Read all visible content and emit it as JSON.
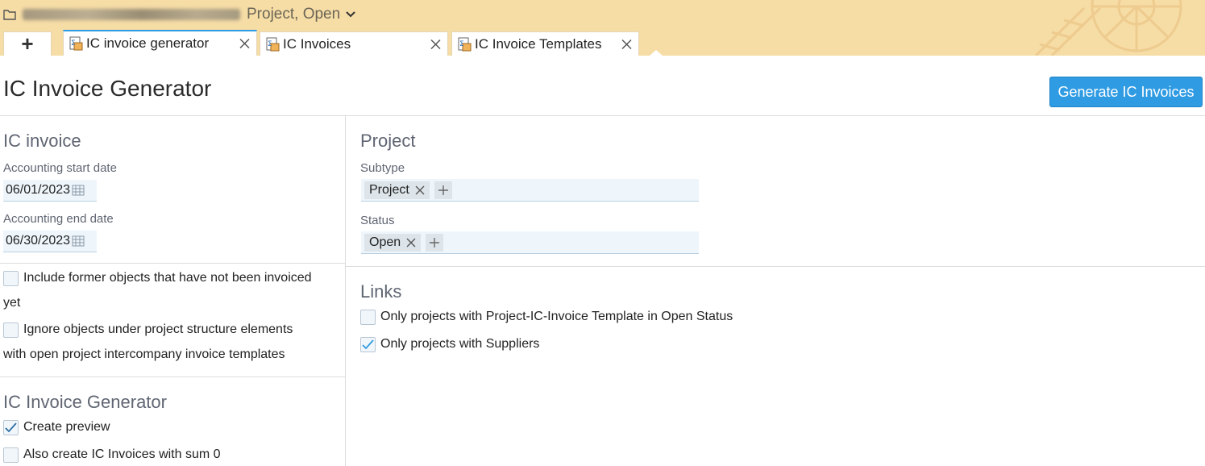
{
  "header": {
    "context_text": "Project, Open",
    "tabs": [
      {
        "label": "IC invoice generator",
        "icon": "ic-invoice-icon",
        "active": true
      },
      {
        "label": "IC Invoices",
        "icon": "ic-invoice-icon",
        "active": false
      },
      {
        "label": "IC Invoice Templates",
        "icon": "ic-invoice-icon",
        "active": false
      }
    ],
    "add_tab_label": "+"
  },
  "page": {
    "title": "IC Invoice Generator",
    "primary_action": "Generate IC Invoices"
  },
  "left": {
    "ic_invoice": {
      "title": "IC invoice",
      "start_label": "Accounting start date",
      "start_value": "06/01/2023",
      "end_label": "Accounting end date",
      "end_value": "06/30/2023"
    },
    "options": {
      "include_former": {
        "line1": "Include former objects that have not been invoiced",
        "line2": "yet",
        "checked": false
      },
      "ignore_objects": {
        "line1": "Ignore objects under project structure elements",
        "line2": "with open project intercompany invoice templates",
        "checked": false
      }
    },
    "generator": {
      "title": "IC Invoice Generator",
      "create_preview": {
        "label": "Create preview",
        "checked": true
      },
      "sum_zero": {
        "label": "Also create IC Invoices with sum 0",
        "checked": false
      }
    }
  },
  "right": {
    "project": {
      "title": "Project",
      "subtype_label": "Subtype",
      "subtype_tags": [
        "Project"
      ],
      "status_label": "Status",
      "status_tags": [
        "Open"
      ]
    },
    "links": {
      "title": "Links",
      "template_open": {
        "label": "Only projects with Project-IC-Invoice Template in Open Status",
        "checked": false
      },
      "suppliers": {
        "label": "Only projects with Suppliers",
        "checked": true
      }
    }
  },
  "colors": {
    "header_bg": "#f6dca5",
    "accent": "#2f9be3",
    "input_bg": "#eef6fc",
    "section_text": "#5f6572"
  },
  "icons": [
    "folder-icon",
    "chevron-down-icon",
    "ic-invoice-icon",
    "close-icon",
    "calendar-icon",
    "check-icon",
    "plus-icon"
  ]
}
